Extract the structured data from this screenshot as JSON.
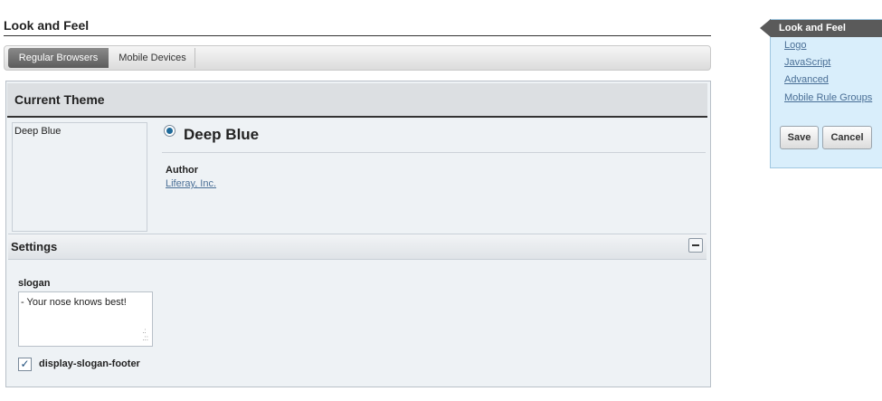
{
  "page": {
    "title": "Look and Feel"
  },
  "tabs": [
    {
      "label": "Regular Browsers",
      "active": true
    },
    {
      "label": "Mobile Devices",
      "active": false
    }
  ],
  "current_theme": {
    "header": "Current Theme",
    "thumbnail_alt": "Deep Blue",
    "name": "Deep Blue",
    "selected": true,
    "author_label": "Author",
    "author_name": "Liferay, Inc."
  },
  "settings": {
    "header": "Settings",
    "slogan_label": "slogan",
    "slogan_value": "- Your nose knows best!",
    "checkbox_label": "display-slogan-footer",
    "checkbox_checked": true
  },
  "sidebar": {
    "title": "Look and Feel",
    "links": [
      "Logo",
      "JavaScript",
      "Advanced",
      "Mobile Rule Groups"
    ],
    "save_label": "Save",
    "cancel_label": "Cancel"
  },
  "colors": {
    "link": "#4a6f96",
    "sidebar_bg": "#d9eefb",
    "sidebar_header": "#5a5a5a",
    "radio_fill": "#1e6a9a"
  }
}
